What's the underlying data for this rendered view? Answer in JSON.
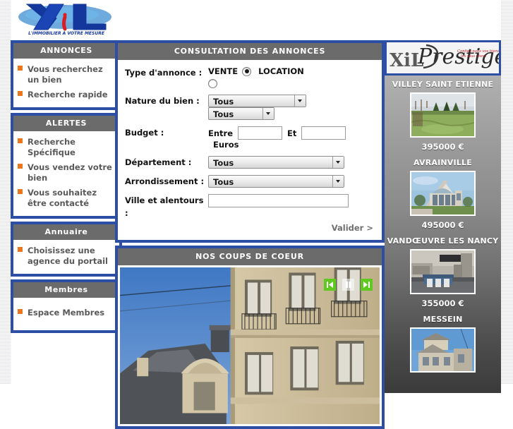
{
  "site": {
    "logo_text": "XiL",
    "logo_tagline": "L'IMMOBILIER A VOTRE MESURE"
  },
  "sidebar": {
    "sections": [
      {
        "title": "ANNONCES",
        "items": [
          {
            "label": "Vous recherchez un bien"
          },
          {
            "label": "Recherche rapide"
          }
        ]
      },
      {
        "title": "ALERTES",
        "items": [
          {
            "label": "Recherche Spécifique"
          },
          {
            "label": "Vous vendez votre bien"
          },
          {
            "label": "Vous souhaitez être contacté"
          }
        ]
      },
      {
        "title": "Annuaire",
        "items": [
          {
            "label": "Choisissez une agence du portail"
          }
        ]
      },
      {
        "title": "Membres",
        "items": [
          {
            "label": "Espace Membres"
          }
        ]
      }
    ]
  },
  "search_panel": {
    "title": "CONSULTATION DES ANNONCES",
    "type_label": "Type d'annonce :",
    "type_options": [
      {
        "label": "VENTE",
        "selected": true
      },
      {
        "label": "LOCATION",
        "selected": false
      }
    ],
    "nature_label": "Nature du bien :",
    "nature_value_1": "Tous",
    "nature_value_2": "Tous",
    "budget_label": "Budget :",
    "budget_from_label": "Entre",
    "budget_from_value": "",
    "budget_to_label": "Et",
    "budget_to_value": "",
    "budget_unit": "Euros",
    "departement_label": "Département :",
    "departement_value": "Tous",
    "arrondissement_label": "Arrondissement :",
    "arrondissement_value": "Tous",
    "ville_label": "Ville et alentours :",
    "ville_value": "",
    "submit_label": "Valider >"
  },
  "carousel": {
    "title": "NOS COUPS DE COEUR",
    "prev_icon": "skip-back-icon",
    "pause_icon": "pause-icon",
    "next_icon": "skip-forward-icon"
  },
  "prestige": {
    "brand": "XiL",
    "word": "Prestige",
    "script_line_1": "Confiez-nous vos biens",
    "script_line_2": "les plus chers"
  },
  "featured": {
    "items": [
      {
        "city": "VILLEY SAINT ETIENNE",
        "price": "395000 €"
      },
      {
        "city": "AVRAINVILLE",
        "price": "495000 €"
      },
      {
        "city": "VANDŒUVRE LES NANCY",
        "price": "355000 €"
      },
      {
        "city": "MESSEIN",
        "price": ""
      }
    ]
  },
  "colors": {
    "frame_blue": "#2c4ea4",
    "header_gray": "#6b6b6b",
    "bullet_orange": "#e8771d",
    "button_green": "#5ec91e"
  }
}
